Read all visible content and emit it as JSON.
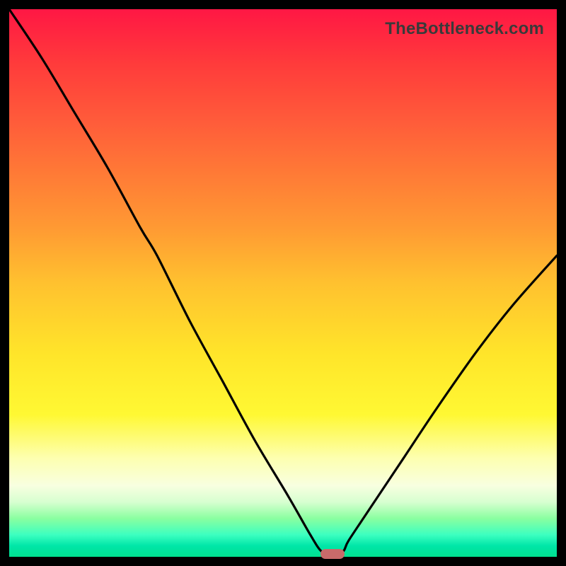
{
  "watermark": "TheBottleneck.com",
  "chart_data": {
    "type": "line",
    "title": "",
    "xlabel": "",
    "ylabel": "",
    "xlim": [
      0,
      100
    ],
    "ylim": [
      0,
      100
    ],
    "series": [
      {
        "name": "bottleneck-curve",
        "x": [
          0,
          6,
          12,
          18,
          24,
          27,
          33,
          39,
          45,
          51,
          55,
          57,
          59,
          61,
          62,
          66,
          72,
          78,
          85,
          92,
          100
        ],
        "values": [
          100,
          91,
          81,
          71,
          60,
          55,
          43,
          32,
          21,
          11,
          4,
          1,
          0,
          1,
          3,
          9,
          18,
          27,
          37,
          46,
          55
        ]
      }
    ],
    "marker": {
      "x": 59,
      "y": 0.5
    },
    "gradient_stops": [
      {
        "pos": 0,
        "color": "#ff1744"
      },
      {
        "pos": 50,
        "color": "#ffc12f"
      },
      {
        "pos": 74,
        "color": "#fff833"
      },
      {
        "pos": 100,
        "color": "#00e090"
      }
    ]
  }
}
